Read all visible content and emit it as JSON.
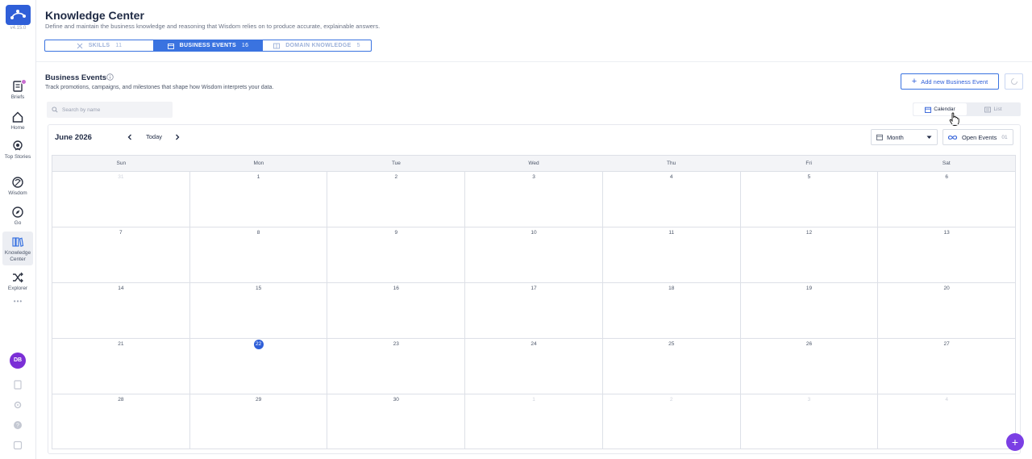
{
  "app": {
    "version": "v4.15.0"
  },
  "sidebar": {
    "items": [
      {
        "label": "Briefs",
        "icon": "briefs-icon"
      },
      {
        "label": "Home",
        "icon": "home-icon"
      },
      {
        "label": "Top Stories",
        "icon": "top-stories-icon"
      },
      {
        "label": "Wisdom",
        "icon": "wisdom-icon"
      },
      {
        "label": "Go",
        "icon": "compass-icon"
      },
      {
        "label": "Knowledge Center",
        "icon": "knowledge-icon",
        "active": true
      },
      {
        "label": "Explorer",
        "icon": "shuffle-icon"
      }
    ],
    "more": "•••",
    "avatar_initials": "DB"
  },
  "header": {
    "title": "Knowledge Center",
    "subtitle": "Define and maintain the business knowledge and reasoning that Wisdom relies on to produce accurate, explainable answers.",
    "tabs": [
      {
        "label": "SKILLS",
        "count": "11"
      },
      {
        "label": "BUSINESS EVENTS",
        "count": "16",
        "active": true
      },
      {
        "label": "DOMAIN KNOWLEDGE",
        "count": "5"
      }
    ]
  },
  "section": {
    "title": "Business Events",
    "subtitle": "Track promotions, campaigns, and milestones that shape how Wisdom interprets your data.",
    "add_button": "Add new Business Event",
    "search_placeholder": "Search by name",
    "view_toggle": {
      "calendar": "Calendar",
      "list": "List",
      "active": "calendar"
    }
  },
  "calendar": {
    "month_label": "June 2026",
    "today_label": "Today",
    "view_select": "Month",
    "open_events_label": "Open Events",
    "open_events_count": "01",
    "weekdays": [
      "Sun",
      "Mon",
      "Tue",
      "Wed",
      "Thu",
      "Fri",
      "Sat"
    ],
    "weeks": [
      [
        "31",
        "1",
        "2",
        "3",
        "4",
        "5",
        "6"
      ],
      [
        "7",
        "8",
        "9",
        "10",
        "11",
        "12",
        "13"
      ],
      [
        "14",
        "15",
        "16",
        "17",
        "18",
        "19",
        "20"
      ],
      [
        "21",
        "22",
        "23",
        "24",
        "25",
        "26",
        "27"
      ],
      [
        "28",
        "29",
        "30",
        "1",
        "2",
        "3",
        "4"
      ]
    ],
    "today": "22"
  },
  "colors": {
    "accent": "#3a73e0",
    "primary_dark": "#1f2a44",
    "fab": "#7b3fe4",
    "avatar": "#7b2fd6"
  },
  "fab_label": "+"
}
